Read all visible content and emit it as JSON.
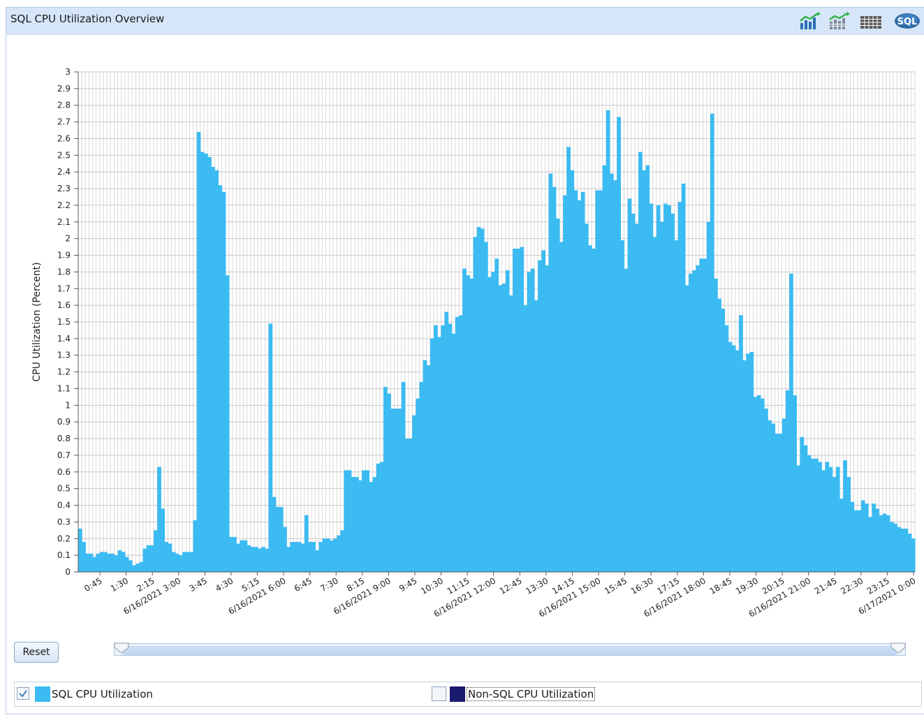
{
  "window": {
    "title": "SQL CPU Utilization Overview"
  },
  "toolbar": {
    "icons": [
      "line-chart-icon",
      "stacked-chart-icon",
      "data-grid-icon",
      "sql-icon"
    ],
    "sql_badge": "SQL"
  },
  "controls": {
    "reset_label": "Reset"
  },
  "legend": {
    "items": [
      {
        "label": "SQL CPU Utilization",
        "color": "#3bbbf2",
        "checked": true
      },
      {
        "label": "Non-SQL CPU Utilization",
        "color": "#1a1a6e",
        "checked": false
      }
    ]
  },
  "chart_data": {
    "type": "bar",
    "title": "",
    "ylabel": "CPU Utilization (Percent)",
    "xlabel": "",
    "ylim": [
      0,
      3
    ],
    "y_ticks": [
      "0",
      "0.1",
      "0.2",
      "0.3",
      "0.4",
      "0.5",
      "0.6",
      "0.7",
      "0.8",
      "0.9",
      "1",
      "1.1",
      "1.2",
      "1.3",
      "1.4",
      "1.5",
      "1.6",
      "1.7",
      "1.8",
      "1.9",
      "2",
      "2.1",
      "2.2",
      "2.3",
      "2.4",
      "2.5",
      "2.6",
      "2.7",
      "2.8",
      "2.9",
      "3"
    ],
    "x_tick_labels": [
      "0:45",
      "1:30",
      "2:15",
      "6/16/2021 3:00",
      "3:45",
      "4:30",
      "5:15",
      "6/16/2021 6:00",
      "6:45",
      "7:30",
      "8:15",
      "6/16/2021 9:00",
      "9:45",
      "10:30",
      "11:15",
      "6/16/2021 12:00",
      "12:45",
      "13:30",
      "14:15",
      "6/16/2021 15:00",
      "15:45",
      "16:30",
      "17:15",
      "6/16/2021 18:00",
      "18:45",
      "19:30",
      "20:15",
      "6/16/2021 21:00",
      "21:45",
      "22:30",
      "23:15",
      "6/17/2021 0:00"
    ],
    "grid": true,
    "legend_position": "bottom",
    "series": [
      {
        "name": "SQL CPU Utilization",
        "color": "#3bbbf2",
        "values": [
          0.26,
          0.18,
          0.11,
          0.11,
          0.09,
          0.11,
          0.12,
          0.12,
          0.11,
          0.11,
          0.1,
          0.13,
          0.12,
          0.09,
          0.07,
          0.04,
          0.05,
          0.06,
          0.14,
          0.16,
          0.16,
          0.25,
          0.63,
          0.38,
          0.18,
          0.17,
          0.12,
          0.11,
          0.1,
          0.12,
          0.12,
          0.12,
          0.31,
          2.64,
          2.52,
          2.51,
          2.49,
          2.43,
          2.41,
          2.32,
          2.28,
          1.78,
          0.21,
          0.21,
          0.17,
          0.19,
          0.19,
          0.16,
          0.15,
          0.15,
          0.14,
          0.15,
          0.14,
          1.49,
          0.45,
          0.39,
          0.39,
          0.27,
          0.15,
          0.18,
          0.18,
          0.18,
          0.17,
          0.34,
          0.18,
          0.18,
          0.13,
          0.18,
          0.2,
          0.2,
          0.19,
          0.2,
          0.22,
          0.25,
          0.61,
          0.61,
          0.57,
          0.57,
          0.55,
          0.61,
          0.61,
          0.54,
          0.57,
          0.65,
          0.66,
          1.11,
          1.07,
          0.98,
          0.98,
          0.98,
          1.14,
          0.8,
          0.8,
          0.94,
          1.04,
          1.14,
          1.27,
          1.24,
          1.4,
          1.48,
          1.41,
          1.48,
          1.56,
          1.49,
          1.43,
          1.53,
          1.54,
          1.82,
          1.78,
          1.76,
          2.01,
          2.07,
          2.06,
          1.98,
          1.77,
          1.8,
          1.88,
          1.72,
          1.73,
          1.81,
          1.66,
          1.94,
          1.94,
          1.95,
          1.6,
          1.8,
          1.82,
          1.63,
          1.87,
          1.93,
          1.84,
          2.39,
          2.31,
          2.12,
          1.98,
          2.26,
          2.55,
          2.41,
          2.29,
          2.23,
          2.28,
          2.09,
          1.96,
          1.94,
          2.29,
          2.29,
          2.44,
          2.77,
          2.39,
          2.35,
          2.73,
          1.99,
          1.82,
          2.24,
          2.15,
          2.09,
          2.52,
          2.41,
          2.44,
          2.21,
          2.01,
          2.2,
          2.1,
          2.21,
          2.2,
          2.15,
          1.99,
          2.22,
          2.33,
          1.72,
          1.79,
          1.81,
          1.84,
          1.88,
          1.88,
          2.1,
          2.75,
          1.76,
          1.64,
          1.58,
          1.48,
          1.38,
          1.36,
          1.33,
          1.54,
          1.27,
          1.31,
          1.32,
          1.05,
          1.06,
          1.04,
          0.98,
          0.91,
          0.89,
          0.83,
          0.83,
          0.92,
          1.09,
          1.79,
          1.06,
          0.64,
          0.81,
          0.76,
          0.7,
          0.68,
          0.68,
          0.66,
          0.61,
          0.66,
          0.63,
          0.57,
          0.63,
          0.44,
          0.67,
          0.57,
          0.42,
          0.37,
          0.37,
          0.43,
          0.41,
          0.33,
          0.41,
          0.38,
          0.34,
          0.35,
          0.34,
          0.3,
          0.29,
          0.27,
          0.26,
          0.26,
          0.23,
          0.2
        ]
      },
      {
        "name": "Non-SQL CPU Utilization",
        "color": "#1a1a6e",
        "values": []
      }
    ]
  }
}
